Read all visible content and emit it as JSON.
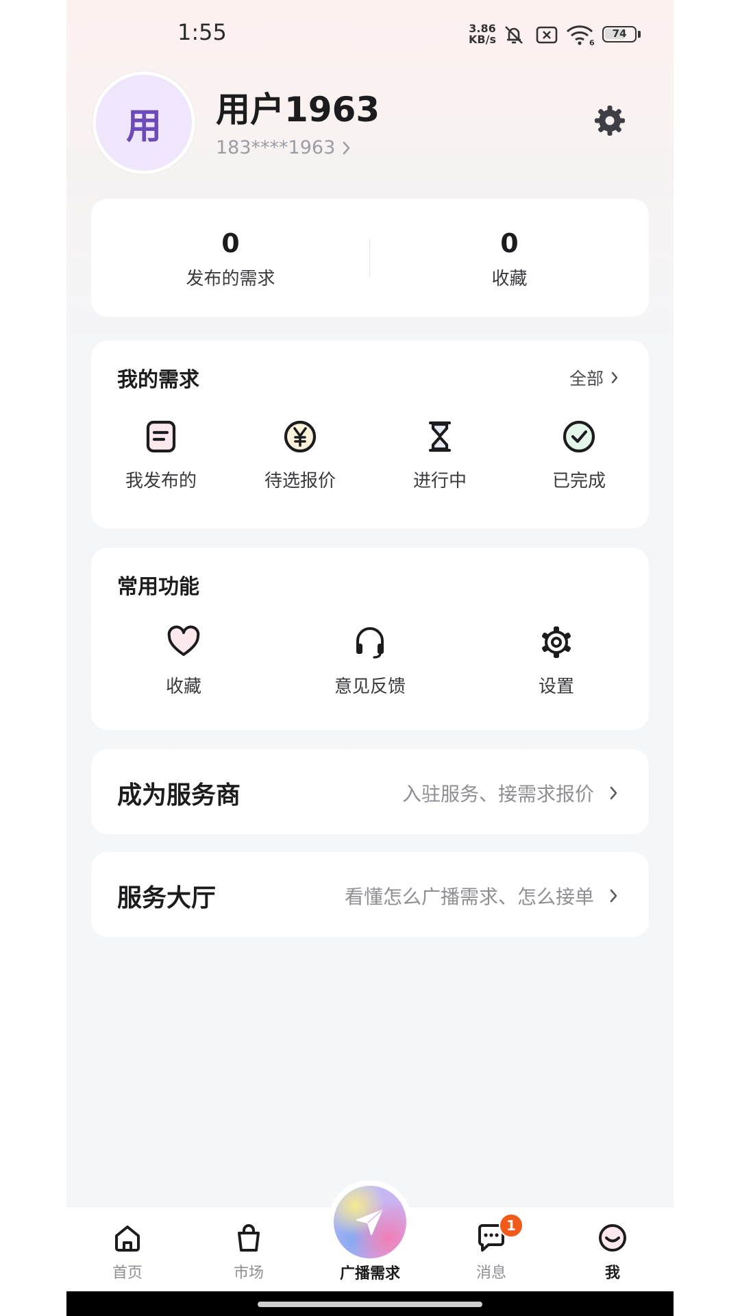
{
  "status_bar": {
    "time": "1:55",
    "net_speed_value": "3.86",
    "net_speed_unit": "KB/s",
    "wifi_label": "6",
    "battery": "74",
    "battery_level": 0.74
  },
  "profile": {
    "avatar_text": "用",
    "username": "用户1963",
    "phone": "183****1963"
  },
  "stats": [
    {
      "value": "0",
      "label": "发布的需求"
    },
    {
      "value": "0",
      "label": "收藏"
    }
  ],
  "my_requests": {
    "title": "我的需求",
    "more_label": "全部",
    "items": [
      {
        "label": "我发布的",
        "icon": "document-icon"
      },
      {
        "label": "待选报价",
        "icon": "yen-coin-icon"
      },
      {
        "label": "进行中",
        "icon": "hourglass-icon"
      },
      {
        "label": "已完成",
        "icon": "check-circle-icon"
      }
    ]
  },
  "functions": {
    "title": "常用功能",
    "items": [
      {
        "label": "收藏",
        "icon": "heart-icon"
      },
      {
        "label": "意见反馈",
        "icon": "headset-icon"
      },
      {
        "label": "设置",
        "icon": "gear-icon"
      }
    ]
  },
  "provider": {
    "title": "成为服务商",
    "subtitle": "入驻服务、接需求报价"
  },
  "service_hall": {
    "title": "服务大厅",
    "subtitle": "看懂怎么广播需求、怎么接单"
  },
  "nav": {
    "items": [
      {
        "label": "首页",
        "icon": "home-icon"
      },
      {
        "label": "市场",
        "icon": "bag-icon"
      },
      {
        "label": "广播需求",
        "icon": "send-icon"
      },
      {
        "label": "消息",
        "icon": "chat-icon"
      },
      {
        "label": "我",
        "icon": "smile-icon"
      }
    ],
    "message_badge": "1",
    "active": "我"
  },
  "colors": {
    "accent_purple": "#6c4ab8",
    "badge_orange": "#f05a1a",
    "icon_fill_pink": "#fbe9ee",
    "icon_fill_yellow": "#fbf2dc",
    "icon_fill_green": "#e4f5ea"
  }
}
